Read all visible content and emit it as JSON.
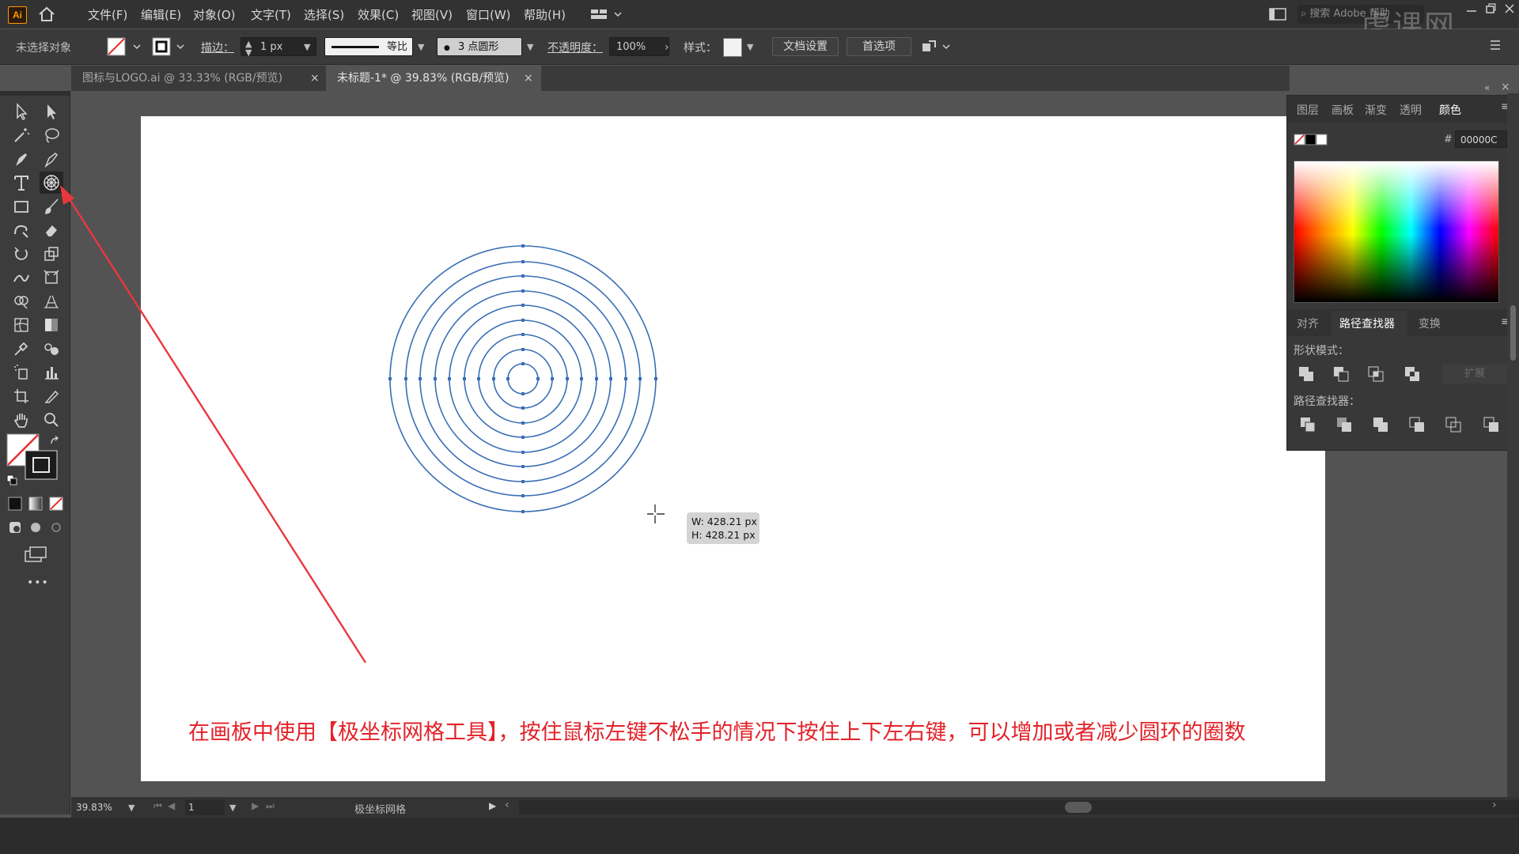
{
  "app": {
    "logo": "Ai"
  },
  "menu": [
    "文件(F)",
    "编辑(E)",
    "对象(O)",
    "文字(T)",
    "选择(S)",
    "效果(C)",
    "视图(V)",
    "窗口(W)",
    "帮助(H)"
  ],
  "search": {
    "placeholder": "搜索 Adobe 帮助"
  },
  "control": {
    "selection_status": "未选择对象",
    "stroke_label": "描边：",
    "stroke_value": "1 px",
    "stroke_profile": "等比",
    "brush": "3 点圆形",
    "opacity_label": "不透明度：",
    "opacity_value": "100%",
    "style_label": "样式：",
    "doc_setup": "文档设置",
    "preferences": "首选项"
  },
  "tabs": [
    {
      "label": "图标与LOGO.ai @ 33.33% (RGB/预览)",
      "close": "×"
    },
    {
      "label": "未标题-1* @ 39.83% (RGB/预览)",
      "close": "×"
    }
  ],
  "tooltip": {
    "w": "W: 428.21 px",
    "h": "H: 428.21 px"
  },
  "caption": "在画板中使用【极坐标网格工具】，按住鼠标左键不松手的情况下按住上下左右键，可以增加或者减少圆环的圈数",
  "panel": {
    "top_tabs": [
      "图层",
      "画板",
      "渐变",
      "透明",
      "颜色"
    ],
    "hex_label": "#",
    "hex_value": "00000C",
    "mid_tabs": [
      "对齐",
      "路径查找器",
      "变换"
    ],
    "shape_modes_label": "形状模式：",
    "expand_label": "扩展",
    "pathfinders_label": "路径查找器："
  },
  "status": {
    "zoom": "39.83%",
    "page": "1",
    "tool": "极坐标网格"
  },
  "colors": {
    "arrow": "#e8383d",
    "circle_stroke": "#3a6fb5",
    "caption": "#e2232a"
  },
  "watermark": "虎课网",
  "toolbar_more": "•••"
}
